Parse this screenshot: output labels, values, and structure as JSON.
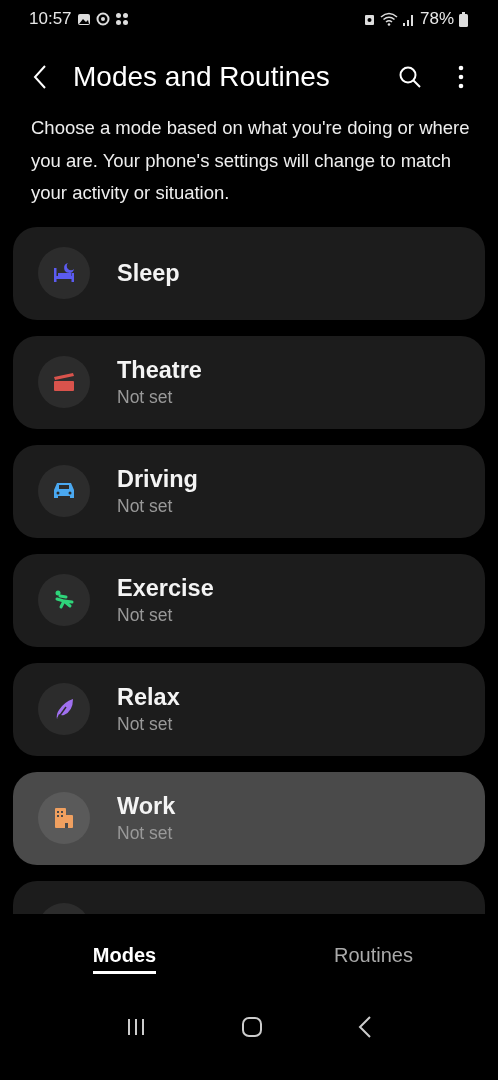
{
  "status_bar": {
    "time": "10:57",
    "battery": "78%"
  },
  "header": {
    "title": "Modes and Routines"
  },
  "description": "Choose a mode based on what you're doing or where you are. Your phone's settings will change to match your activity or situation.",
  "modes": [
    {
      "kind": "sleep",
      "name": "Sleep",
      "color": "#5b5bf0",
      "selected": false
    },
    {
      "kind": "theatre",
      "name": "Theatre",
      "status": "Not set",
      "color": "#d9534c",
      "selected": false
    },
    {
      "kind": "driving",
      "name": "Driving",
      "status": "Not set",
      "color": "#4aa8f0",
      "selected": false
    },
    {
      "kind": "exercise",
      "name": "Exercise",
      "status": "Not set",
      "color": "#2ed57a",
      "selected": false
    },
    {
      "kind": "relax",
      "name": "Relax",
      "status": "Not set",
      "color": "#a070f0",
      "selected": false
    },
    {
      "kind": "work",
      "name": "Work",
      "status": "Not set",
      "color": "#f0a060",
      "selected": true
    }
  ],
  "tabs": [
    {
      "label": "Modes",
      "selected": true
    },
    {
      "label": "Routines",
      "selected": false
    }
  ]
}
